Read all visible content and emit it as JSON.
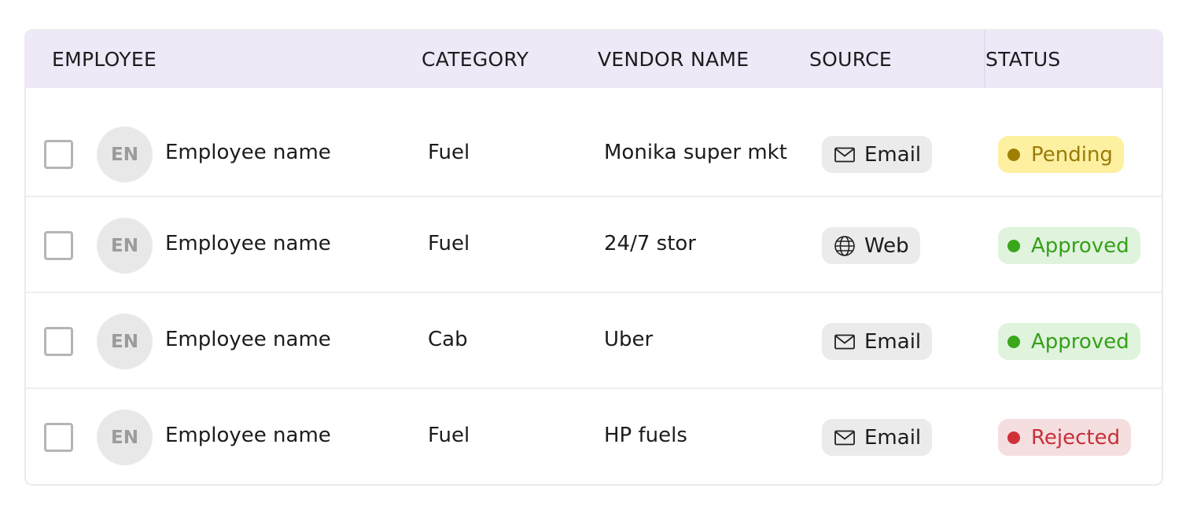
{
  "table": {
    "columns": [
      {
        "key": "employee",
        "label": "EMPLOYEE"
      },
      {
        "key": "category",
        "label": "CATEGORY"
      },
      {
        "key": "vendor",
        "label": "VENDOR NAME"
      },
      {
        "key": "source",
        "label": "SOURCE"
      },
      {
        "key": "status",
        "label": "STATUS"
      }
    ],
    "rows": [
      {
        "checked": false,
        "initials": "EN",
        "employee": "Employee name",
        "category": "Fuel",
        "vendor": "Monika super mkt",
        "source": {
          "label": "Email",
          "icon": "mail-icon"
        },
        "status": {
          "label": "Pending",
          "kind": "pending"
        }
      },
      {
        "checked": false,
        "initials": "EN",
        "employee": "Employee name",
        "category": "Fuel",
        "vendor": "24/7 stor",
        "source": {
          "label": "Web",
          "icon": "globe-icon"
        },
        "status": {
          "label": "Approved",
          "kind": "approved"
        }
      },
      {
        "checked": false,
        "initials": "EN",
        "employee": "Employee name",
        "category": "Cab",
        "vendor": "Uber",
        "source": {
          "label": "Email",
          "icon": "mail-icon"
        },
        "status": {
          "label": "Approved",
          "kind": "approved"
        }
      },
      {
        "checked": false,
        "initials": "EN",
        "employee": "Employee name",
        "category": "Fuel",
        "vendor": "HP fuels",
        "source": {
          "label": "Email",
          "icon": "mail-icon"
        },
        "status": {
          "label": "Rejected",
          "kind": "rejected"
        }
      }
    ]
  },
  "colors": {
    "header_bg": "#eee8f7",
    "pending": {
      "bg": "#fdf0a0",
      "fg": "#9a7b0a",
      "dot": "#a07f06"
    },
    "approved": {
      "bg": "#dff3dd",
      "fg": "#36a019",
      "dot": "#3aa61a"
    },
    "rejected": {
      "bg": "#f5dedf",
      "fg": "#c4303a",
      "dot": "#cf3039"
    }
  }
}
